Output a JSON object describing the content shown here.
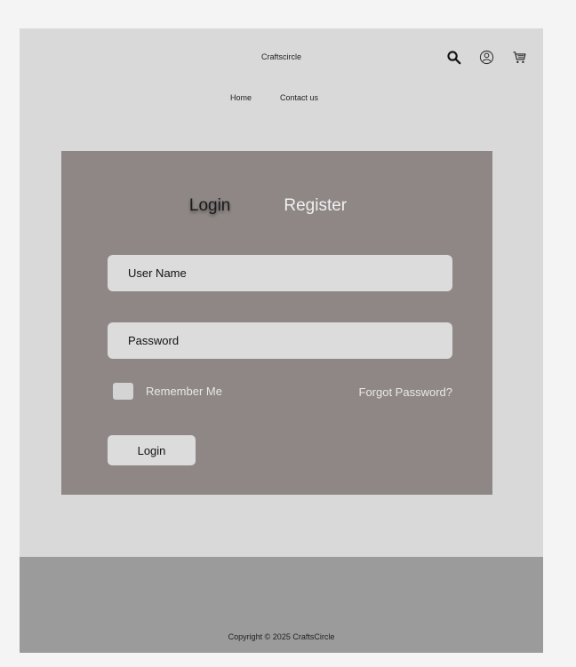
{
  "header": {
    "brand": "Craftscircle",
    "icons": [
      "search-icon",
      "user-icon",
      "cart-icon"
    ]
  },
  "nav": {
    "items": [
      {
        "label": "Home"
      },
      {
        "label": "Contact us"
      }
    ]
  },
  "auth": {
    "tabs": [
      {
        "label": "Login",
        "active": true
      },
      {
        "label": "Register",
        "active": false
      }
    ],
    "username_placeholder": "User Name",
    "password_placeholder": "Password",
    "remember_label": "Remember Me",
    "remember_checked": false,
    "forgot_label": "Forgot Password?",
    "submit_label": "Login"
  },
  "footer": {
    "copyright": "Copyright © 2025 CraftsCircle"
  },
  "colors": {
    "page_bg": "#f4f4f4",
    "frame_bg": "#d9d9d9",
    "card_bg": "#8e8786",
    "footer_bg": "#9b9b9b",
    "field_bg": "#dcdcdc"
  }
}
